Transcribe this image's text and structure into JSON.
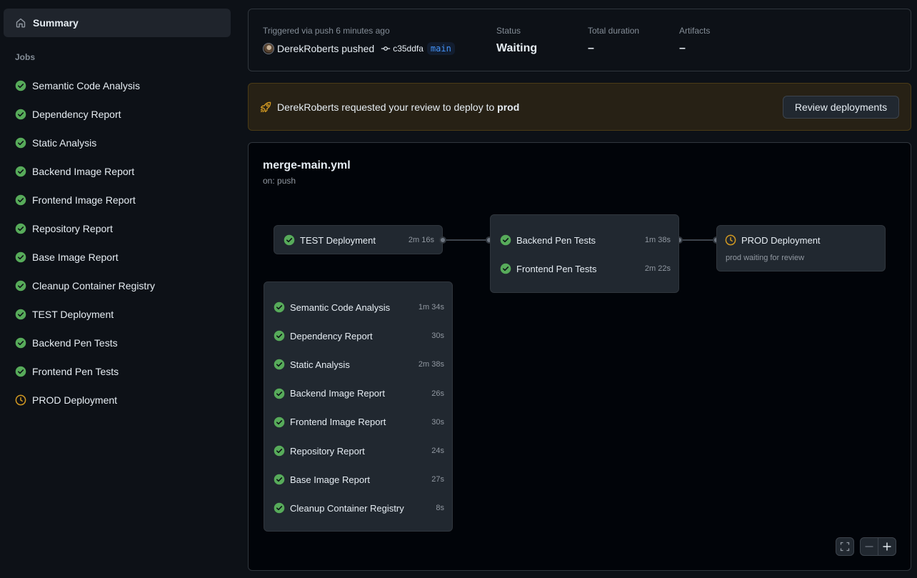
{
  "sidebar": {
    "summary_label": "Summary",
    "jobs_heading": "Jobs",
    "jobs": [
      {
        "label": "Semantic Code Analysis",
        "status": "success"
      },
      {
        "label": "Dependency Report",
        "status": "success"
      },
      {
        "label": "Static Analysis",
        "status": "success"
      },
      {
        "label": "Backend Image Report",
        "status": "success"
      },
      {
        "label": "Frontend Image Report",
        "status": "success"
      },
      {
        "label": "Repository Report",
        "status": "success"
      },
      {
        "label": "Base Image Report",
        "status": "success"
      },
      {
        "label": "Cleanup Container Registry",
        "status": "success"
      },
      {
        "label": "TEST Deployment",
        "status": "success"
      },
      {
        "label": "Backend Pen Tests",
        "status": "success"
      },
      {
        "label": "Frontend Pen Tests",
        "status": "success"
      },
      {
        "label": "PROD Deployment",
        "status": "waiting"
      }
    ]
  },
  "run": {
    "trigger_text": "Triggered via push 6 minutes ago",
    "pusher_text": "DerekRoberts pushed",
    "commit_sha": "c35ddfa",
    "branch": "main",
    "status_label": "Status",
    "status_value": "Waiting",
    "duration_label": "Total duration",
    "duration_value": "–",
    "artifacts_label": "Artifacts",
    "artifacts_value": "–"
  },
  "review": {
    "text_prefix": "DerekRoberts requested your review to deploy to ",
    "environment": "prod",
    "button_label": "Review deployments"
  },
  "workflow": {
    "file_name": "merge-main.yml",
    "trigger": "on: push",
    "test_deploy": {
      "label": "TEST Deployment",
      "time": "2m 16s"
    },
    "pen_tests": [
      {
        "label": "Backend Pen Tests",
        "time": "1m 38s"
      },
      {
        "label": "Frontend Pen Tests",
        "time": "2m 22s"
      }
    ],
    "prod_deploy": {
      "label": "PROD Deployment",
      "sub": "prod waiting for review"
    },
    "analysis_jobs": [
      {
        "label": "Semantic Code Analysis",
        "time": "1m 34s"
      },
      {
        "label": "Dependency Report",
        "time": "30s"
      },
      {
        "label": "Static Analysis",
        "time": "2m 38s"
      },
      {
        "label": "Backend Image Report",
        "time": "26s"
      },
      {
        "label": "Frontend Image Report",
        "time": "30s"
      },
      {
        "label": "Repository Report",
        "time": "24s"
      },
      {
        "label": "Base Image Report",
        "time": "27s"
      },
      {
        "label": "Cleanup Container Registry",
        "time": "8s"
      }
    ]
  },
  "colors": {
    "success": "#57ab5a",
    "waiting": "#d29922",
    "accent": "#4493f8"
  },
  "icons": {
    "summary": "home-icon",
    "success": "check-circle-fill-icon",
    "waiting": "clock-icon",
    "commit": "git-commit-icon",
    "review": "rocket-icon",
    "fullscreen": "screen-full-icon",
    "zoom_out": "dash-icon",
    "zoom_in": "plus-icon"
  }
}
